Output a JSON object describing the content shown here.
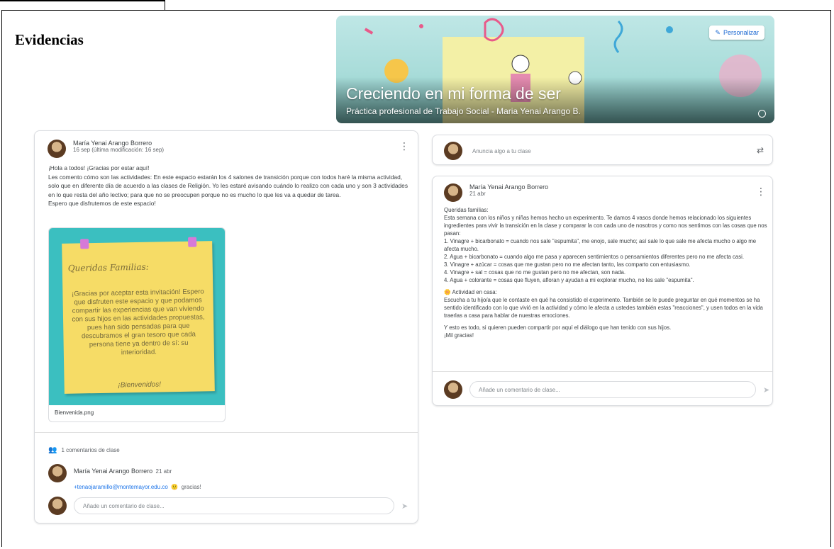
{
  "document": {
    "section_title": "Evidencias"
  },
  "banner": {
    "title": "Creciendo en mi forma de ser",
    "subtitle": "Práctica profesional de Trabajo Social - Maria Yenai Arango B.",
    "customize_label": "Personalizar",
    "accent_colors": [
      "#a8dcd9",
      "#f48fb1",
      "#fdd835",
      "#74b8b4"
    ]
  },
  "left_post": {
    "author": "María Yenai Arango Borrero",
    "date": "16 sep (última modificación: 16 sep)",
    "paragraphs": [
      "¡Hola a todos! ¡Gracias por estar aquí!",
      "Les comento cómo son las actividades: En este espacio estarán los 4 salones de transición porque con todos haré la misma actividad, solo que en diferente día de acuerdo a las clases de Religión. Yo les estaré avisando cuándo lo realizo con cada uno y son 3 actividades en lo que resta del año lectivo; para que no se preocupen porque no es mucho lo que les va a quedar de tarea.",
      "Espero que disfrutemos de este espacio!"
    ],
    "attachment": {
      "heading": "Queridas Familias:",
      "text": "¡Gracias por aceptar esta invitación! Espero que disfruten este espacio y que podamos compartir las experiencias que van viviendo con sus hijos en las actividades propuestas, pues han sido pensadas para que descubramos el gran tesoro que cada persona tiene ya dentro de sí: su interioridad.",
      "welcome": "¡Bienvenidos!",
      "filename": "Bienvenida.png",
      "note_color": "#f6dc66",
      "bg_color": "#3bbfc0"
    },
    "comments_label": "1 comentarios de clase",
    "comment": {
      "author": "María Yenai Arango Borrero",
      "date": "21 abr",
      "link": "+tenaojaramillo@montemayor.edu.co",
      "emoji": "🙂",
      "text": "gracias!"
    },
    "add_comment_placeholder": "Añade un comentario de clase..."
  },
  "announce": {
    "placeholder": "Anuncia algo a tu clase"
  },
  "right_post": {
    "author": "María Yenai Arango Borrero",
    "date": "21 abr",
    "paragraphs": [
      "Queridas familias:",
      "Esta semana con los niños y niñas hemos hecho un experimento. Te damos 4 vasos donde hemos relacionado los siguientes ingredientes para vivir la transición en la clase y comparar la con cada uno de nosotros y como nos sentimos con las cosas que nos pasan:",
      "1. Vinagre + bicarbonato = cuando nos sale \"espumita\", me enojo, sale mucho; así sale lo que sale me afecta mucho o algo me afecta mucho.",
      "2. Agua + bicarbonato = cuando algo me pasa y aparecen sentimientos o pensamientos diferentes pero no me afecta casi.",
      "3. Vinagre + azúcar = cosas que me gustan pero no me afectan tanto, las comparto con entusiasmo.",
      "4. Vinagre + sal = cosas que no me gustan pero no me afectan, son nada.",
      "4. Agua + colorante = cosas que fluyen, afloran y ayudan a mi explorar mucho, no les sale \"espumita\".",
      "🌼 Actividad en casa:",
      "Escucha a tu hijo/a que le contaste en qué ha consistido el experimento. También se le puede preguntar en qué momentos se ha sentido identificado con lo que vivió en la actividad y cómo le afecta a ustedes también estas \"reacciones\", y usen todos en la vida traerlas a casa para hablar de nuestras emociones.",
      "Y esto es todo, si quieren pueden compartir por aquí el diálogo que han tenido con sus hijos.",
      "¡Mil gracias!"
    ],
    "add_comment_placeholder": "Añade un comentario de clase..."
  }
}
